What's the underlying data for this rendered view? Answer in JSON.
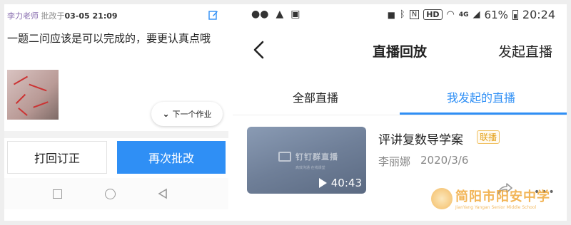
{
  "left_phone": {
    "comment_teacher": "李力老师",
    "comment_time_prefix": "批改于",
    "comment_time": "03-05 21:09",
    "comment_text": "一题二问应该是可以完成的，要更认真点哦",
    "next_homework_label": "下一个作业",
    "return_button_label": "打回订正",
    "regrade_button_label": "再次批改",
    "accent_color": "#2f8ff5"
  },
  "right_phone": {
    "status_bar": {
      "hd": "HD",
      "n": "N",
      "network": "4G",
      "battery": "61%",
      "time": "20:24"
    },
    "app_bar": {
      "title": "直播回放",
      "action_label": "发起直播"
    },
    "tabs": [
      {
        "label": "全部直播",
        "active": false
      },
      {
        "label": "我发起的直播",
        "active": true
      }
    ],
    "video": {
      "thumb_logo": "钉钉群直播",
      "thumb_subtitle": "高效沟通  在线课堂",
      "duration": "40:43",
      "title": "评讲复数导学案",
      "badge": "联播",
      "author": "李丽娜",
      "date": "2020/3/6"
    }
  },
  "watermark": {
    "name_cn": "简阳市阳安中学",
    "name_en": "JianYang Yangan Senior Middle School"
  }
}
